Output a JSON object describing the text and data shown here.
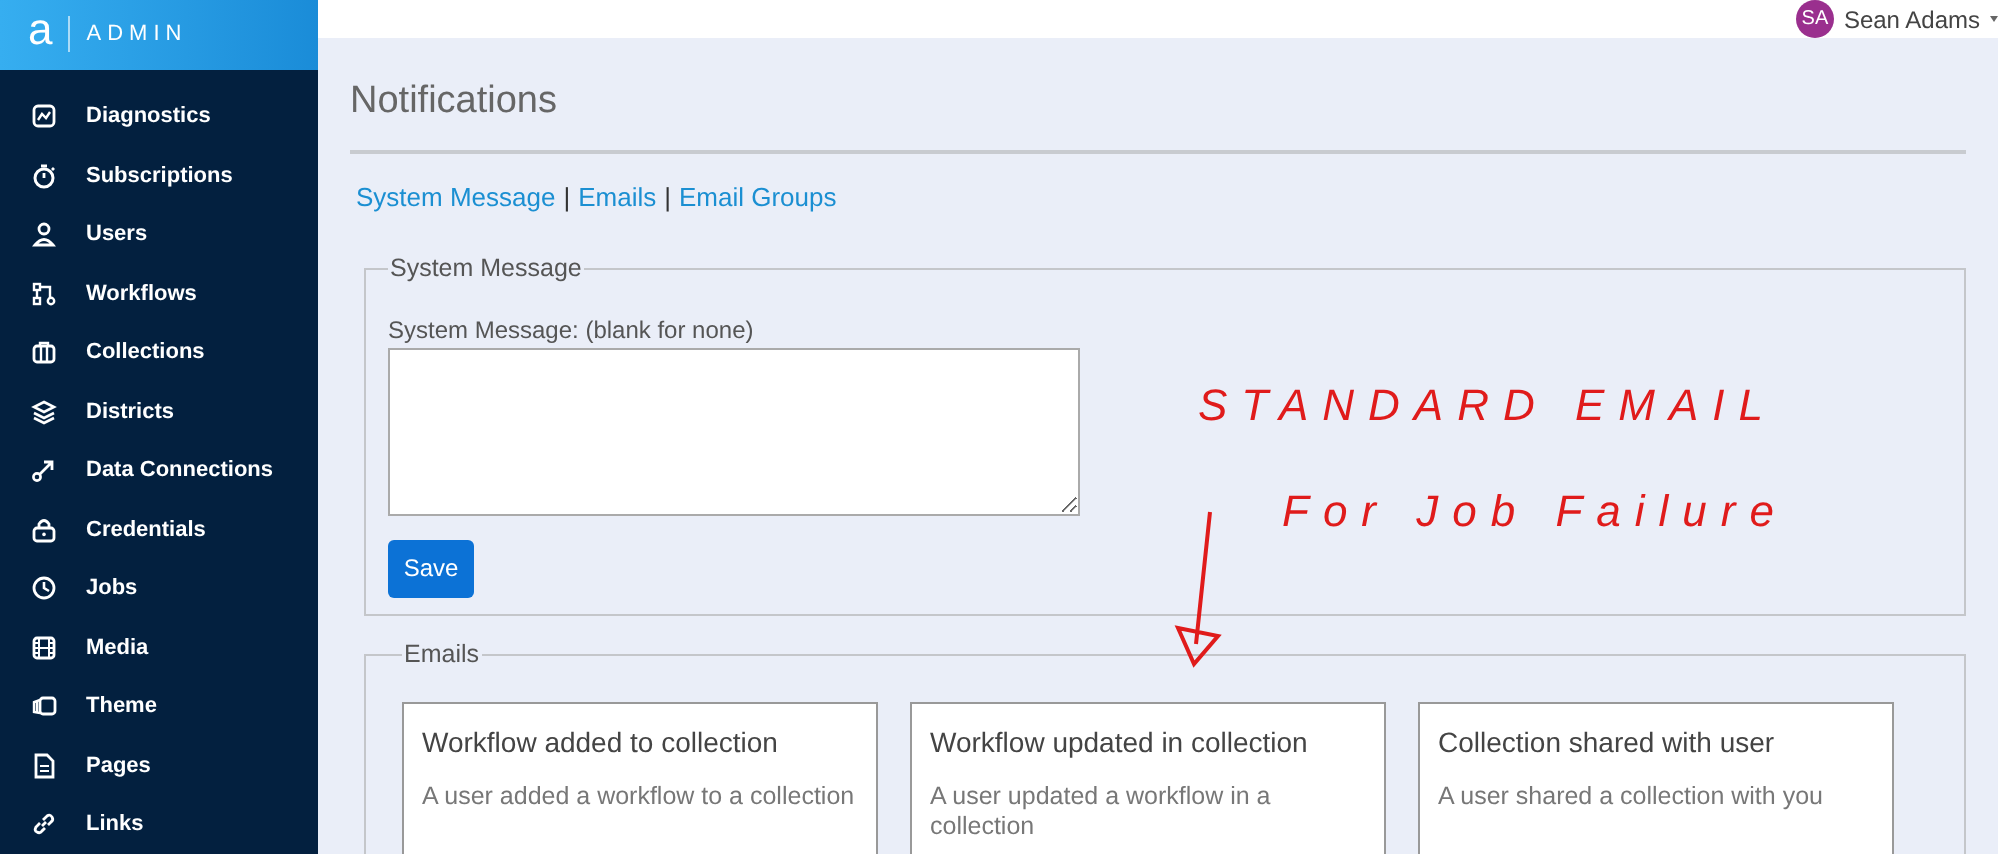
{
  "logo": {
    "letter": "a",
    "product": "ADMIN"
  },
  "sidebar": {
    "items": [
      {
        "label": "Diagnostics"
      },
      {
        "label": "Subscriptions"
      },
      {
        "label": "Users"
      },
      {
        "label": "Workflows"
      },
      {
        "label": "Collections"
      },
      {
        "label": "Districts"
      },
      {
        "label": "Data Connections"
      },
      {
        "label": "Credentials"
      },
      {
        "label": "Jobs"
      },
      {
        "label": "Media"
      },
      {
        "label": "Theme"
      },
      {
        "label": "Pages"
      },
      {
        "label": "Links"
      }
    ]
  },
  "user": {
    "initials": "SA",
    "name": "Sean Adams"
  },
  "page": {
    "title": "Notifications",
    "links": [
      {
        "label": "System Message"
      },
      {
        "label": "Emails"
      },
      {
        "label": "Email Groups"
      }
    ],
    "separator": "|"
  },
  "system_message": {
    "legend": "System Message",
    "field_label": "System Message: (blank for none)",
    "button": "Save"
  },
  "emails": {
    "legend": "Emails",
    "cards": [
      {
        "title": "Workflow added to collection",
        "description": "A user added a workflow to a collection"
      },
      {
        "title": "Workflow updated in collection",
        "description": "A user updated a workflow in a collection"
      },
      {
        "title": "Collection shared with user",
        "description": "A user shared a collection with you"
      }
    ]
  },
  "annotation": {
    "lines": [
      "STANDARD EMAIL",
      "For Job Failure"
    ]
  }
}
